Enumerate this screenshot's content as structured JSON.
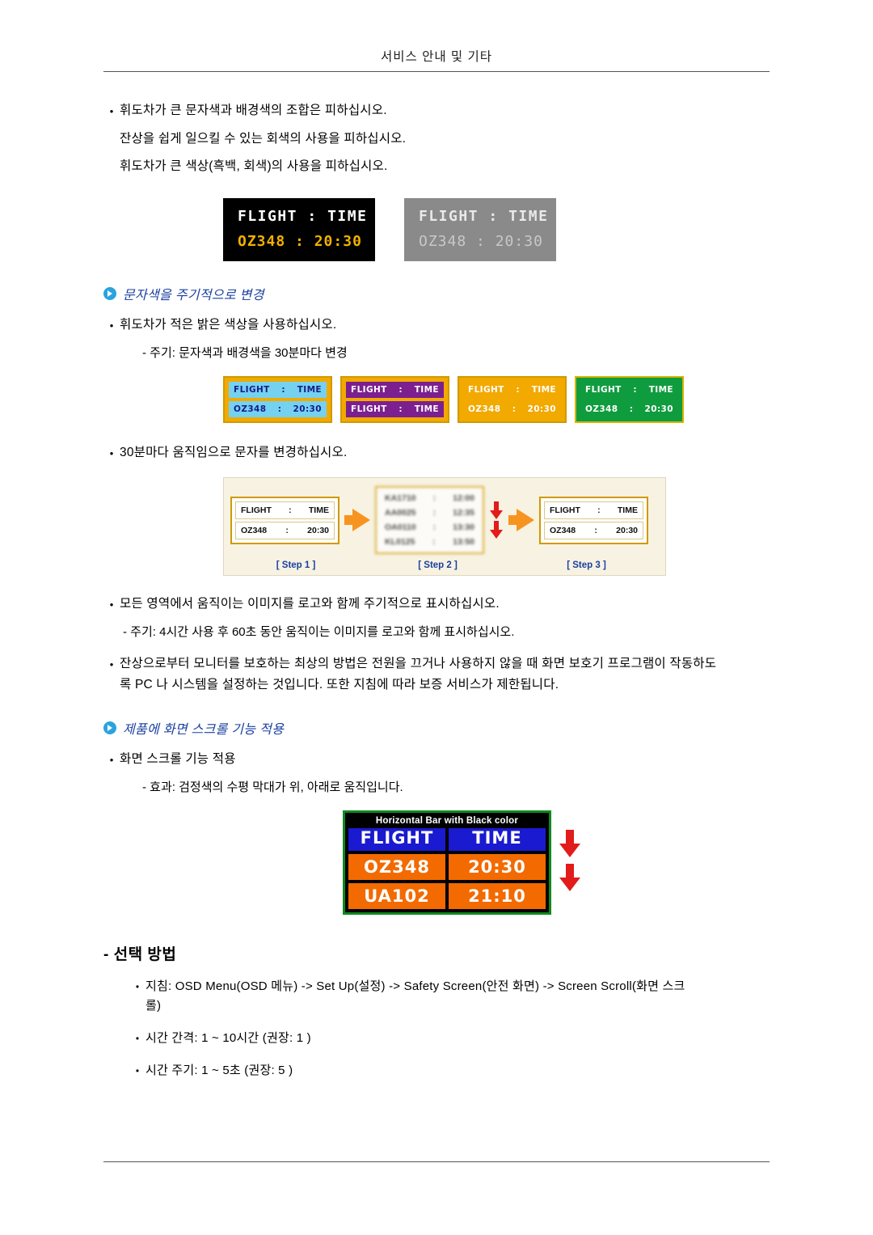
{
  "header": {
    "title": "서비스 안내 및 기타"
  },
  "intro": {
    "bullet1": "휘도차가 큰 문자색과 배경색의 조합은 피하십시오.",
    "line2": "잔상을 쉽게 일으킬 수 있는 회색의 사용을 피하십시오.",
    "line3": "휘도차가 큰 색상(흑백, 회색)의 사용을 피하십시오."
  },
  "figure1": {
    "board_black": {
      "row1_label": "FLIGHT",
      "row1_sep": ":",
      "row1_value": "TIME",
      "row2_label": "OZ348",
      "row2_sep": ":",
      "row2_value": "20:30"
    },
    "board_gray": {
      "row1_label": "FLIGHT",
      "row1_sep": ":",
      "row1_value": "TIME",
      "row2_label": "OZ348",
      "row2_sep": ":",
      "row2_value": "20:30"
    }
  },
  "section1": {
    "heading": "문자색을 주기적으로 변경",
    "bullet": "휘도차가 적은 밝은 색상을 사용하십시오.",
    "dash": "- 주기: 문자색과 배경색을 30분마다 변경"
  },
  "figure2": {
    "boards": [
      {
        "r1_label": "FLIGHT",
        "r1_sep": ":",
        "r1_value": "TIME",
        "r2_label": "OZ348",
        "r2_sep": ":",
        "r2_value": "20:30"
      },
      {
        "r1_label": "FLIGHT",
        "r1_sep": ":",
        "r1_value": "TIME",
        "r2_label": "FLIGHT",
        "r2_sep": ":",
        "r2_value": "TIME"
      },
      {
        "r1_label": "FLIGHT",
        "r1_sep": ":",
        "r1_value": "TIME",
        "r2_label": "OZ348",
        "r2_sep": ":",
        "r2_value": "20:30"
      },
      {
        "r1_label": "FLIGHT",
        "r1_sep": ":",
        "r1_value": "TIME",
        "r2_label": "OZ348",
        "r2_sep": ":",
        "r2_value": "20:30"
      }
    ]
  },
  "section2": {
    "bullet": "30분마다 움직임으로 문자를 변경하십시오."
  },
  "figure3": {
    "step1": {
      "r1_label": "FLIGHT",
      "r1_sep": ":",
      "r1_value": "TIME",
      "r2_label": "OZ348",
      "r2_sep": ":",
      "r2_value": "20:30"
    },
    "step2": {
      "r1_label": "KA1710",
      "r1_sep": ":",
      "r1_value": "12:00",
      "r2_label": "AA0025",
      "r2_sep": ":",
      "r2_value": "12:35",
      "r3_label": "OA0110",
      "r3_sep": ":",
      "r3_value": "13:30",
      "r4_label": "KL0125",
      "r4_sep": ":",
      "r4_value": "13:50"
    },
    "step3": {
      "r1_label": "FLIGHT",
      "r1_sep": ":",
      "r1_value": "TIME",
      "r2_label": "OZ348",
      "r2_sep": ":",
      "r2_value": "20:30"
    },
    "caption1": "[ Step 1 ]",
    "caption2": "[ Step 2 ]",
    "caption3": "[ Step 3 ]"
  },
  "section3": {
    "bullet": "모든 영역에서 움직이는 이미지를 로고와 함께 주기적으로 표시하십시오.",
    "dash": "- 주기: 4시간 사용 후 60초 동안 움직이는 이미지를 로고와 함께 표시하십시오.",
    "bullet2": "잔상으로부터 모니터를 보호하는 최상의 방법은 전원을 끄거나 사용하지 않을 때 화면 보호기 프로그램이 작동하도록 PC 나 시스템을 설정하는 것입니다. 또한 지침에 따라 보증 서비스가 제한됩니다."
  },
  "section4": {
    "heading": "제품에 화면 스크롤 기능 적용",
    "bullet": "화면 스크롤 기능 적용",
    "dash": "- 효과: 검정색의 수평 막대가 위, 아래로 움직입니다."
  },
  "figure4": {
    "caption": "Horizontal Bar with Black color",
    "row1_left": "FLIGHT",
    "row1_right": "TIME",
    "row2_left": "OZ348",
    "row2_right": "20:30",
    "row3_left": "UA102",
    "row3_right": "21:10"
  },
  "selection": {
    "heading": "- 선택 방법",
    "item1": "지침: OSD Menu(OSD 메뉴) -> Set Up(설정) -> Safety Screen(안전 화면) -> Screen Scroll(화면 스크롤)",
    "item2": "시간 간격: 1 ~ 10시간 (권장: 1 )",
    "item3": "시간 주기: 1 ~ 5초 (권장: 5 )"
  },
  "colors": {
    "accent_blue": "#1a3fa0",
    "arrow_orange": "#f79420",
    "arrow_red": "#e21b1b",
    "board_amber": "#f0b000",
    "green_border": "#0f8a1f"
  }
}
